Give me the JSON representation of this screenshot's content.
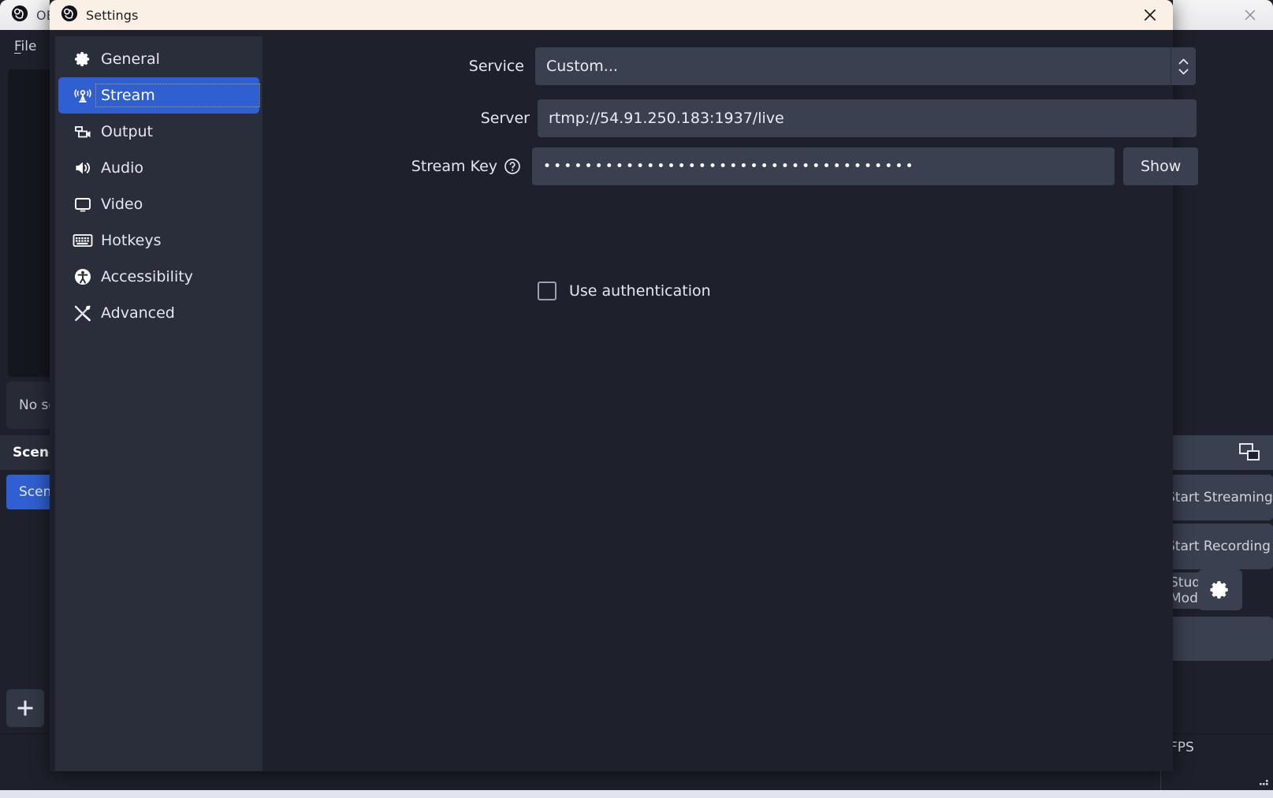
{
  "main_window": {
    "title": "OBS",
    "logo_icon": "obs-logo-icon",
    "close_icon": "close-icon",
    "menu": [
      {
        "label": "File",
        "accel": "F"
      }
    ],
    "left_dock": {
      "no_source_text": "No source selected",
      "scenes_header": "Scenes",
      "scene_item": "Scene",
      "add_icon": "plus-icon"
    },
    "right_dock": {
      "multiview_icon": "multiview-icon",
      "start_streaming": "Start Streaming",
      "start_recording": "Start Recording",
      "studio_mode": "Studio Mode",
      "settings_gear_icon": "gear-icon"
    },
    "status_bar": {
      "fps_text": "FPS",
      "resize_grip_icon": "resize-grip-icon"
    }
  },
  "dialog": {
    "title": "Settings",
    "logo_icon": "obs-logo-icon",
    "close_icon": "close-icon",
    "sidebar": {
      "items": [
        {
          "label": "General",
          "icon": "gear-icon",
          "selected": false
        },
        {
          "label": "Stream",
          "icon": "broadcast-icon",
          "selected": true
        },
        {
          "label": "Output",
          "icon": "video-camera-icon",
          "selected": false
        },
        {
          "label": "Audio",
          "icon": "speaker-icon",
          "selected": false
        },
        {
          "label": "Video",
          "icon": "monitor-icon",
          "selected": false
        },
        {
          "label": "Hotkeys",
          "icon": "keyboard-icon",
          "selected": false
        },
        {
          "label": "Accessibility",
          "icon": "accessibility-icon",
          "selected": false
        },
        {
          "label": "Advanced",
          "icon": "tools-icon",
          "selected": false
        }
      ]
    },
    "stream_page": {
      "service_label": "Service",
      "service_value": "Custom...",
      "service_spinner_icon": "chevron-updown-icon",
      "server_label": "Server",
      "server_value": "rtmp://54.91.250.183:1937/live",
      "stream_key_label": "Stream Key",
      "stream_key_help_icon": "help-circle-icon",
      "stream_key_value": "••••••••••••••••••••••••••••••••••••",
      "show_button_label": "Show",
      "use_auth_label": "Use authentication",
      "use_auth_checked": false
    }
  },
  "colors": {
    "dialog_titlebar": "#faf0e6",
    "dialog_body": "#1e212b",
    "sidebar": "#2a2e3b",
    "accent_selected": "#2f5fd0",
    "field_bg": "#3b4050",
    "text_primary": "#e4e7ef",
    "focus_outline": "#c9a227"
  }
}
